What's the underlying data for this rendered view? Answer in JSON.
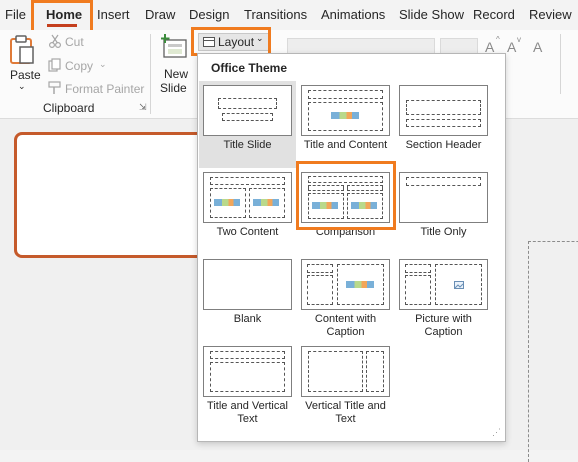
{
  "tabs": [
    "File",
    "Home",
    "Insert",
    "Draw",
    "Design",
    "Transitions",
    "Animations",
    "Slide Show",
    "Record",
    "Review"
  ],
  "ribbon": {
    "paste_label": "Paste",
    "cut_label": "Cut",
    "copy_label": "Copy",
    "format_painter_label": "Format Painter",
    "clipboard_group_label": "Clipboard",
    "new_slide_label_1": "New",
    "new_slide_label_2": "Slide",
    "layout_label": "Layout",
    "font_grow_label": "A",
    "font_shrink_label": "A",
    "clear_format_label": "A"
  },
  "layout_menu": {
    "title": "Office Theme",
    "items": [
      {
        "label": "Title Slide",
        "selected": true
      },
      {
        "label": "Title and Content"
      },
      {
        "label": "Section Header"
      },
      {
        "label": "Two Content"
      },
      {
        "label": "Comparison"
      },
      {
        "label": "Title Only"
      },
      {
        "label": "Blank"
      },
      {
        "label": "Content with Caption"
      },
      {
        "label": "Picture with Caption"
      },
      {
        "label": "Title and Vertical Text"
      },
      {
        "label": "Vertical Title and Text"
      }
    ]
  },
  "highlight_color": "#f07b1f",
  "accent_color": "#c43e1c"
}
